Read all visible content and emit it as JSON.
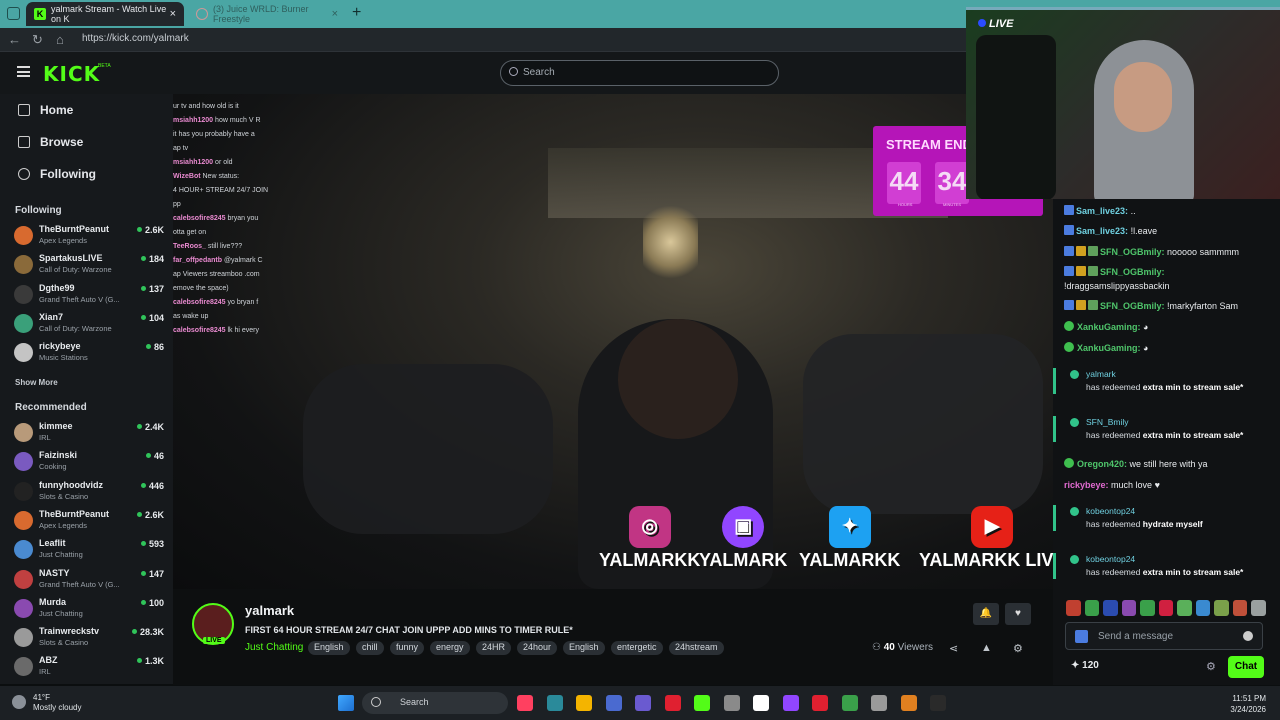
{
  "browser": {
    "tabs": [
      {
        "title": "yalmark Stream - Watch Live on K",
        "close": "×"
      },
      {
        "title": "(3) Juice WRLD: Burner Freestyle",
        "close": "×"
      }
    ],
    "new_tab": "+",
    "url": "https://kick.com/yalmark",
    "back": "←",
    "refresh": "↻",
    "home": "⌂"
  },
  "header": {
    "logo": "KICK",
    "beta": "BETA",
    "search_placeholder": "Search"
  },
  "sidebar": {
    "nav": [
      {
        "label": "Home"
      },
      {
        "label": "Browse"
      },
      {
        "label": "Following"
      }
    ],
    "following_title": "Following",
    "following": [
      {
        "name": "TheBurntPeanut",
        "category": "Apex Legends",
        "viewers": "2.6K",
        "color": "#d86a2f"
      },
      {
        "name": "SpartakusLIVE",
        "category": "Call of Duty: Warzone",
        "viewers": "184",
        "color": "#8a6a3a"
      },
      {
        "name": "Dgthe99",
        "category": "Grand Theft Auto V (G...",
        "viewers": "137",
        "color": "#3a3a3a"
      },
      {
        "name": "Xian7",
        "category": "Call of Duty: Warzone",
        "viewers": "104",
        "color": "#3aa07a"
      },
      {
        "name": "rickybeye",
        "category": "Music Stations",
        "viewers": "86",
        "color": "#c4c4c4"
      }
    ],
    "show_more": "Show More",
    "recommended_title": "Recommended",
    "recommended": [
      {
        "name": "kimmee",
        "category": "IRL",
        "viewers": "2.4K",
        "color": "#b89a7a"
      },
      {
        "name": "Faizinski",
        "category": "Cooking",
        "viewers": "46",
        "color": "#7a5ac0"
      },
      {
        "name": "funnyhoodvidz",
        "category": "Slots & Casino",
        "viewers": "446",
        "color": "#222222"
      },
      {
        "name": "TheBurntPeanut",
        "category": "Apex Legends",
        "viewers": "2.6K",
        "color": "#d86a2f"
      },
      {
        "name": "Leaflit",
        "category": "Just Chatting",
        "viewers": "593",
        "color": "#4a8ad0"
      },
      {
        "name": "NASTY",
        "category": "Grand Theft Auto V (G...",
        "viewers": "147",
        "color": "#c04040"
      },
      {
        "name": "Murda",
        "category": "Just Chatting",
        "viewers": "100",
        "color": "#8a4ab0"
      },
      {
        "name": "Trainwreckstv",
        "category": "Slots & Casino",
        "viewers": "28.3K",
        "color": "#9a9a9a"
      },
      {
        "name": "ABZ",
        "category": "IRL",
        "viewers": "1.3K",
        "color": "#6a6a6a"
      }
    ]
  },
  "overlay_chat": [
    {
      "user": "",
      "text": "ur tv and how old is it"
    },
    {
      "user": "msiahh1200",
      "text": "how much V R"
    },
    {
      "user": "",
      "text": "it has you probably have a"
    },
    {
      "user": "",
      "text": "ap tv"
    },
    {
      "user": "msiahh1200",
      "text": "or old"
    },
    {
      "user": "WizeBot",
      "text": "New status:"
    },
    {
      "user": "",
      "text": "4 HOUR+ STREAM 24/7 JOIN"
    },
    {
      "user": "",
      "text": "pp"
    },
    {
      "user": "calebsofire8245",
      "text": "bryan you"
    },
    {
      "user": "",
      "text": "otta get on"
    },
    {
      "user": "TeeRoos_",
      "text": "still live???"
    },
    {
      "user": "far_offpedantb",
      "text": "@yalmark C"
    },
    {
      "user": "",
      "text": "ap Viewers streamboo .com"
    },
    {
      "user": "",
      "text": "emove the space)"
    },
    {
      "user": "calebsofire8245",
      "text": "yo bryan f"
    },
    {
      "user": "",
      "text": "as wake up"
    },
    {
      "user": "calebsofire8245",
      "text": "lk hi every"
    }
  ],
  "timer": {
    "title": "STREAM ENDS",
    "hours": "44",
    "minutes": "34",
    "hours_label": "HOURS",
    "minutes_label": "MINUTES"
  },
  "socials": [
    {
      "platform": "instagram",
      "handle": "YALMARKK",
      "color": "#c13584",
      "glyph": "◎"
    },
    {
      "platform": "twitch",
      "handle": "YALMARK",
      "color": "#9146ff",
      "glyph": "▣"
    },
    {
      "platform": "twitter",
      "handle": "YALMARKK",
      "color": "#1da1f2",
      "glyph": "✦"
    },
    {
      "platform": "youtube",
      "handle": "YALMARKK LIVE",
      "color": "#e62117",
      "glyph": "▶"
    }
  ],
  "webcam": {
    "live_label": "LIVE"
  },
  "chat": {
    "messages": [
      {
        "user": "Sam_live23:",
        "text": "..",
        "badges": 1
      },
      {
        "user": "Sam_live23:",
        "text": "!l.eave",
        "badges": 1
      },
      {
        "user": "SFN_OGBmily:",
        "text": "nooooo sammmm",
        "badges": 3
      },
      {
        "user": "SFN_OGBmily:",
        "text": "",
        "badges": 3
      },
      {
        "user": "",
        "text": "!draggsamslippyassbackin",
        "badges": 0
      },
      {
        "user": "SFN_OGBmily:",
        "text": "!markyfarton Sam",
        "badges": 3
      },
      {
        "user": "XankuGaming:",
        "text": "",
        "badges": 0
      },
      {
        "user": "XankuGaming:",
        "text": "",
        "badges": 0
      }
    ],
    "redeem1": {
      "user": "yalmark",
      "text": "has redeemed",
      "reward": "extra min to stream sale*"
    },
    "redeem2": {
      "user": "SFN_Bmily",
      "text": "has redeemed",
      "reward": "extra min to stream sale*"
    },
    "msg_oregon": {
      "user": "Oregon420:",
      "text": "we still here with ya"
    },
    "msg_ricky": {
      "user": "rickybeye:",
      "text": "much love ♥"
    },
    "redeem3": {
      "user": "kobeontop24",
      "text": "has redeemed",
      "reward": "hydrate myself"
    },
    "redeem4": {
      "user": "kobeontop24",
      "text": "has redeemed",
      "reward": "extra min to stream sale*"
    },
    "input_placeholder": "Send a message",
    "points": "120",
    "send_label": "Chat",
    "emote_colors": [
      "#c04030",
      "#3aa04a",
      "#2b4cb0",
      "#8a4ab0",
      "#3aa04a",
      "#d02040",
      "#5ab05a",
      "#3a8ad0",
      "#7aa04a",
      "#c0503a",
      "#9aa0a0"
    ]
  },
  "stream": {
    "name": "yalmark",
    "live_badge": "LIVE",
    "title": "FIRST 64 HOUR STREAM 24/7 CHAT JOIN UPPP ADD MINS TO TIMER RULE*",
    "category": "Just Chatting",
    "tags": [
      "English",
      "chill",
      "funny",
      "energy",
      "24HR",
      "24hour",
      "English",
      "entergetic",
      "24hstream"
    ],
    "viewers": "40",
    "viewers_label": "Viewers"
  },
  "taskbar": {
    "temp": "41°F",
    "weather": "Mostly cloudy",
    "search": "Search",
    "time": "11:51 PM",
    "date": "3/24/2026",
    "app_colors": [
      "#ff4060",
      "#2a8a9a",
      "#f4b400",
      "#4a6ad0",
      "#6a5ad0",
      "#e02030",
      "#53fc18",
      "#8a8a8a",
      "#ffffff",
      "#9146ff",
      "#e02030",
      "#3aa04a",
      "#9a9a9a",
      "#e08020",
      "#2a2a2a"
    ]
  }
}
